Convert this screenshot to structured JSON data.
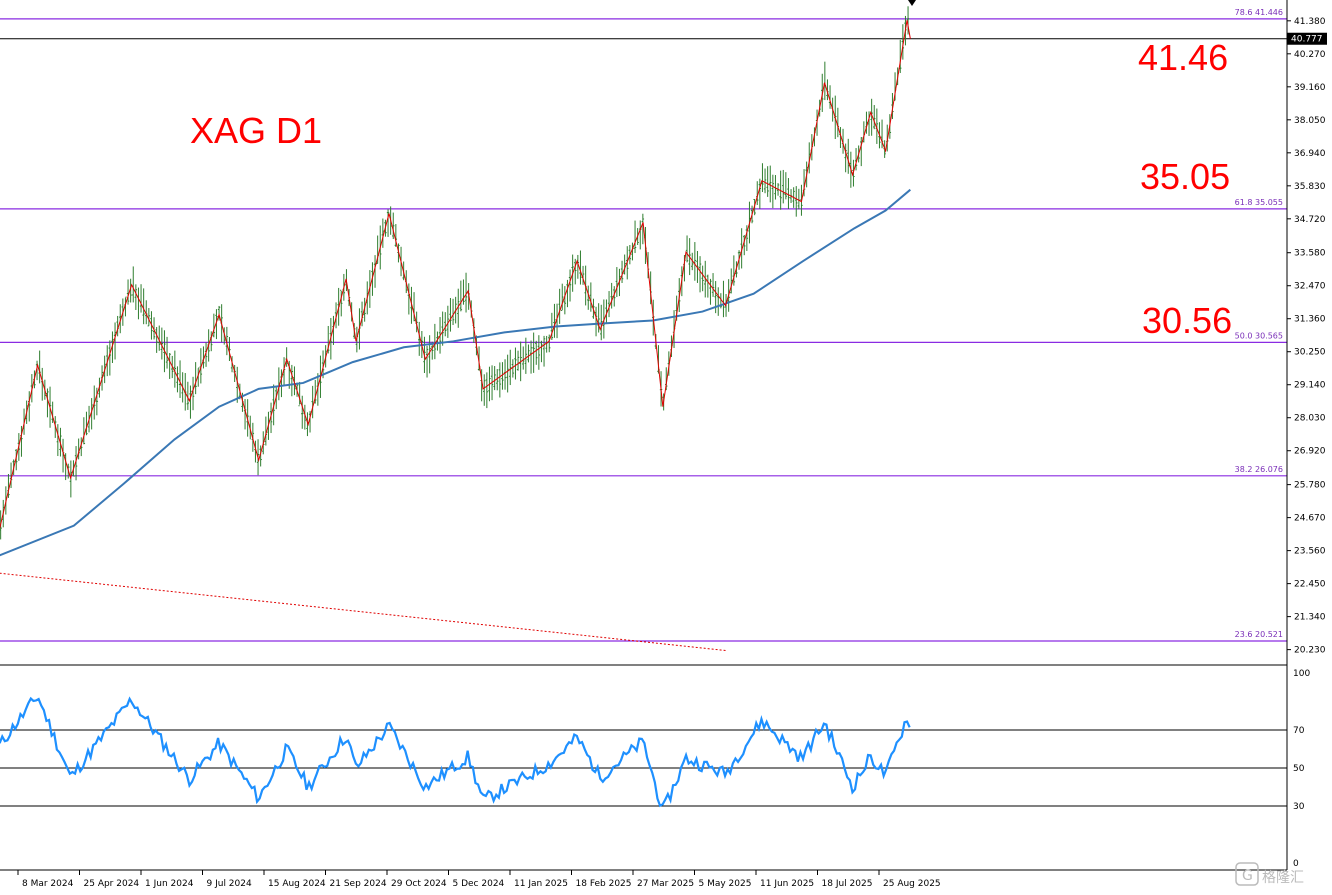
{
  "chart_title": "XAG D1",
  "annotations": [
    "41.46",
    "35.05",
    "30.56"
  ],
  "current_price": "40.777",
  "watermark": "格隆汇",
  "colors": {
    "candle": "#2e7d2e",
    "zigzag": "#e00000",
    "ma": "#3a78b5",
    "fib": "#8a2be2",
    "rsi": "#1e90ff",
    "annotation": "#ff0000"
  },
  "chart_data": {
    "type": "line",
    "title": "XAG D1",
    "main": {
      "ylim": [
        20.0,
        42.0
      ],
      "y_ticks": [
        "41.380",
        "40.270",
        "39.160",
        "38.050",
        "36.940",
        "35.830",
        "34.720",
        "33.580",
        "32.470",
        "31.360",
        "30.250",
        "29.140",
        "28.030",
        "26.920",
        "25.780",
        "24.670",
        "23.560",
        "22.450",
        "21.340",
        "20.230"
      ],
      "x_ticks": [
        "8 Mar 2024",
        "25 Apr 2024",
        "1 Jun 2024",
        "9 Jul 2024",
        "15 Aug 2024",
        "21 Sep 2024",
        "29 Oct 2024",
        "5 Dec 2024",
        "11 Jan 2025",
        "18 Feb 2025",
        "27 Mar 2025",
        "5 May 2025",
        "11 Jun 2025",
        "18 Jul 2025",
        "25 Aug 2025"
      ],
      "fib_levels": [
        {
          "label": "78.6 41.446",
          "value": 41.446
        },
        {
          "label": "61.8 35.055",
          "value": 35.055
        },
        {
          "label": "50.0 30.565",
          "value": 30.565
        },
        {
          "label": "38.2 26.076",
          "value": 26.076
        },
        {
          "label": "23.6 20.521",
          "value": 20.521
        }
      ],
      "zigzag": [
        {
          "date": "2024-03-01",
          "value": 24.3
        },
        {
          "date": "2024-03-24",
          "value": 29.8
        },
        {
          "date": "2024-04-13",
          "value": 26.0
        },
        {
          "date": "2024-05-20",
          "value": 32.5
        },
        {
          "date": "2024-06-24",
          "value": 28.6
        },
        {
          "date": "2024-07-12",
          "value": 31.5
        },
        {
          "date": "2024-08-05",
          "value": 26.6
        },
        {
          "date": "2024-08-22",
          "value": 30.0
        },
        {
          "date": "2024-09-04",
          "value": 27.8
        },
        {
          "date": "2024-09-27",
          "value": 32.7
        },
        {
          "date": "2024-10-03",
          "value": 30.6
        },
        {
          "date": "2024-10-23",
          "value": 34.9
        },
        {
          "date": "2024-11-14",
          "value": 30.0
        },
        {
          "date": "2024-12-10",
          "value": 32.3
        },
        {
          "date": "2024-12-19",
          "value": 29.0
        },
        {
          "date": "2025-01-28",
          "value": 30.6
        },
        {
          "date": "2025-02-14",
          "value": 33.3
        },
        {
          "date": "2025-02-28",
          "value": 31.0
        },
        {
          "date": "2025-03-26",
          "value": 34.6
        },
        {
          "date": "2025-04-07",
          "value": 28.4
        },
        {
          "date": "2025-04-21",
          "value": 33.6
        },
        {
          "date": "2025-05-15",
          "value": 31.8
        },
        {
          "date": "2025-06-06",
          "value": 36.0
        },
        {
          "date": "2025-06-30",
          "value": 35.3
        },
        {
          "date": "2025-07-14",
          "value": 39.3
        },
        {
          "date": "2025-07-31",
          "value": 36.2
        },
        {
          "date": "2025-08-11",
          "value": 38.3
        },
        {
          "date": "2025-08-20",
          "value": 37.0
        },
        {
          "date": "2025-09-02",
          "value": 41.4
        },
        {
          "date": "2025-09-04",
          "value": 40.777
        }
      ],
      "moving_average": [
        {
          "date": "2024-03-01",
          "value": 23.4
        },
        {
          "date": "2024-04-15",
          "value": 24.4
        },
        {
          "date": "2024-05-15",
          "value": 25.8
        },
        {
          "date": "2024-06-15",
          "value": 27.3
        },
        {
          "date": "2024-07-12",
          "value": 28.4
        },
        {
          "date": "2024-08-05",
          "value": 29.0
        },
        {
          "date": "2024-09-01",
          "value": 29.2
        },
        {
          "date": "2024-10-01",
          "value": 29.9
        },
        {
          "date": "2024-11-01",
          "value": 30.4
        },
        {
          "date": "2024-12-01",
          "value": 30.6
        },
        {
          "date": "2025-01-01",
          "value": 30.9
        },
        {
          "date": "2025-02-01",
          "value": 31.1
        },
        {
          "date": "2025-03-01",
          "value": 31.2
        },
        {
          "date": "2025-04-01",
          "value": 31.3
        },
        {
          "date": "2025-05-01",
          "value": 31.6
        },
        {
          "date": "2025-06-01",
          "value": 32.2
        },
        {
          "date": "2025-07-01",
          "value": 33.3
        },
        {
          "date": "2025-08-01",
          "value": 34.4
        },
        {
          "date": "2025-08-20",
          "value": 35.0
        },
        {
          "date": "2025-09-04",
          "value": 35.7
        }
      ],
      "trendline": [
        {
          "date": "2024-03-01",
          "value": 22.8
        },
        {
          "date": "2025-05-15",
          "value": 20.2
        }
      ]
    },
    "rsi": {
      "ylim": [
        0,
        100
      ],
      "levels": [
        70,
        50,
        30
      ],
      "y_ticks": [
        "100",
        "70",
        "50",
        "30",
        "0"
      ],
      "values": [
        {
          "date": "2024-03-01",
          "value": 62
        },
        {
          "date": "2024-03-24",
          "value": 88
        },
        {
          "date": "2024-04-13",
          "value": 45
        },
        {
          "date": "2024-05-20",
          "value": 86
        },
        {
          "date": "2024-06-24",
          "value": 44
        },
        {
          "date": "2024-07-12",
          "value": 63
        },
        {
          "date": "2024-08-05",
          "value": 34
        },
        {
          "date": "2024-08-22",
          "value": 60
        },
        {
          "date": "2024-09-04",
          "value": 40
        },
        {
          "date": "2024-09-27",
          "value": 67
        },
        {
          "date": "2024-10-03",
          "value": 50
        },
        {
          "date": "2024-10-23",
          "value": 72
        },
        {
          "date": "2024-11-14",
          "value": 40
        },
        {
          "date": "2024-12-10",
          "value": 56
        },
        {
          "date": "2024-12-19",
          "value": 33
        },
        {
          "date": "2025-01-28",
          "value": 52
        },
        {
          "date": "2025-02-14",
          "value": 66
        },
        {
          "date": "2025-02-28",
          "value": 45
        },
        {
          "date": "2025-03-26",
          "value": 64
        },
        {
          "date": "2025-04-07",
          "value": 27
        },
        {
          "date": "2025-04-21",
          "value": 55
        },
        {
          "date": "2025-05-15",
          "value": 47
        },
        {
          "date": "2025-06-06",
          "value": 75
        },
        {
          "date": "2025-06-30",
          "value": 55
        },
        {
          "date": "2025-07-14",
          "value": 74
        },
        {
          "date": "2025-07-31",
          "value": 40
        },
        {
          "date": "2025-08-11",
          "value": 56
        },
        {
          "date": "2025-08-20",
          "value": 46
        },
        {
          "date": "2025-09-02",
          "value": 77
        },
        {
          "date": "2025-09-04",
          "value": 69
        }
      ]
    }
  }
}
